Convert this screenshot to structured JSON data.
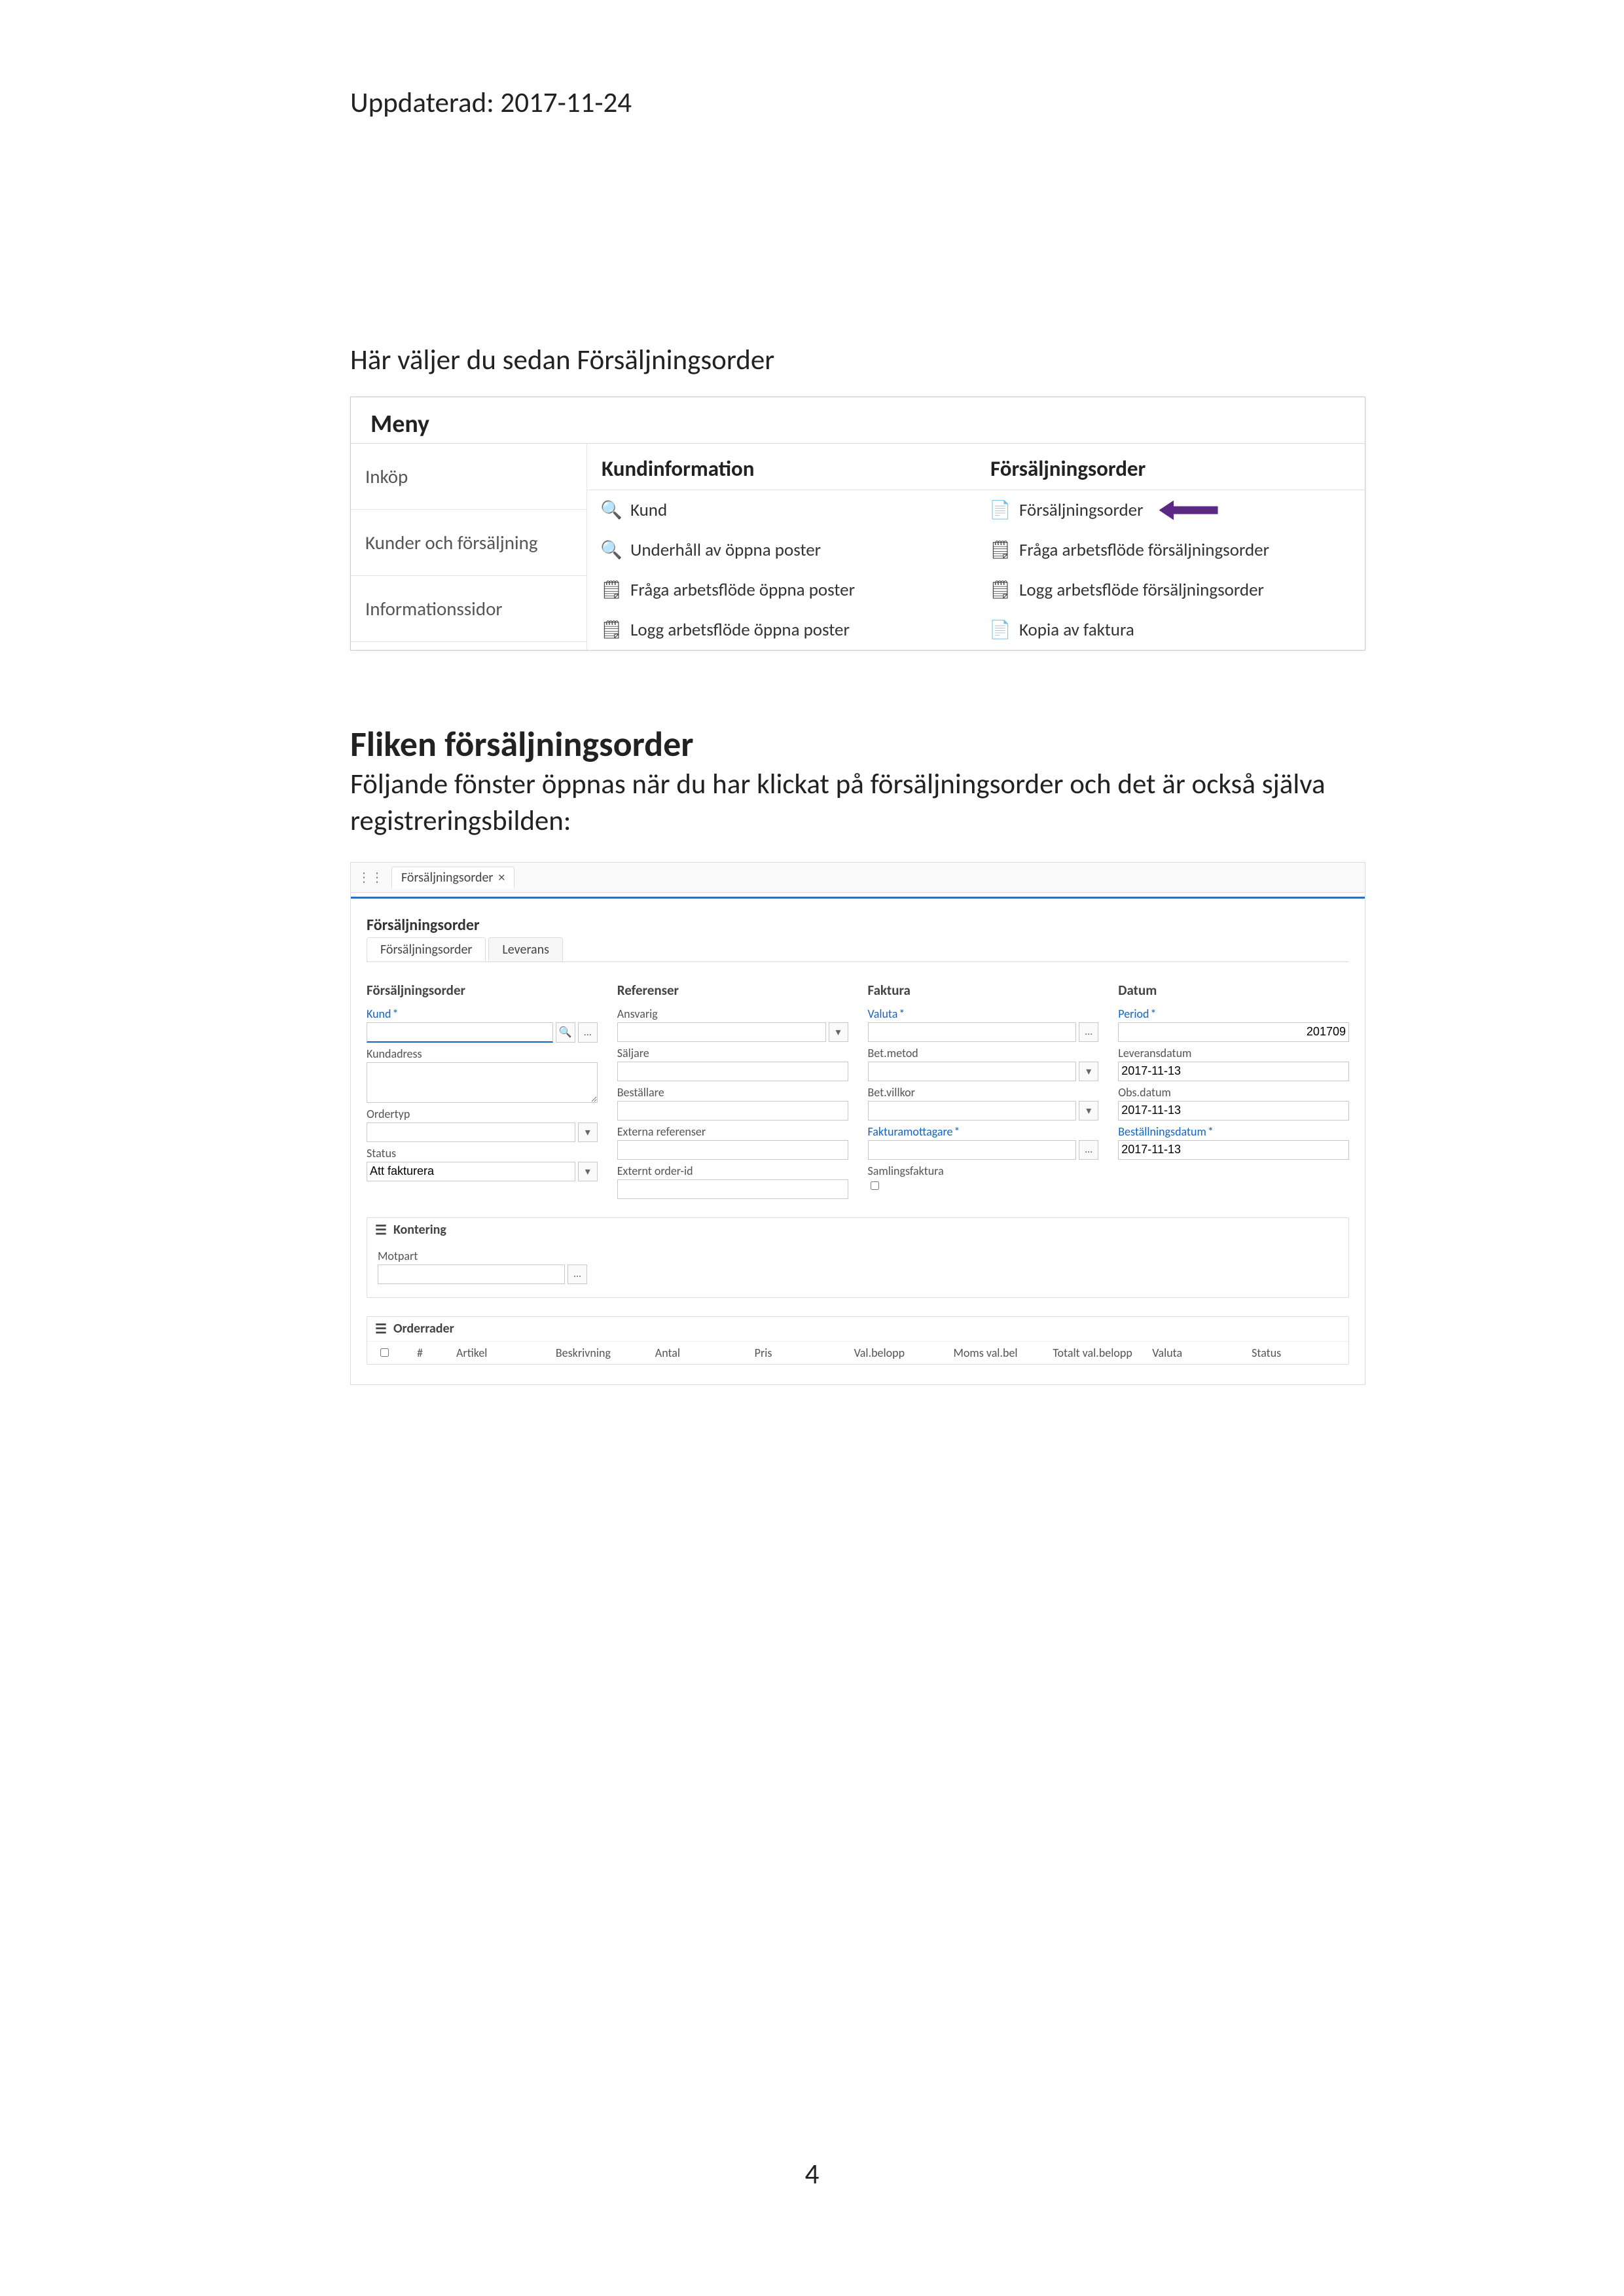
{
  "updated": "Uppdaterad: 2017-11-24",
  "instruction": "Här väljer du sedan Försäljningsorder",
  "section_title": "Fliken försäljningsorder",
  "section_body": "Följande fönster öppnas när du har klickat på försäljningsorder och det är också själva registreringsbilden:",
  "page_number": "4",
  "menu": {
    "title": "Meny",
    "sidebar": [
      "Inköp",
      "Kunder och försäljning",
      "Informationssidor"
    ],
    "col1": {
      "heading": "Kundinformation",
      "items": [
        "Kund",
        "Underhåll av öppna poster",
        "Fråga arbetsflöde öppna poster",
        "Logg arbetsflöde öppna poster"
      ]
    },
    "col2": {
      "heading": "Försäljningsorder",
      "items": [
        "Försäljningsorder",
        "Fråga arbetsflöde försäljningsorder",
        "Logg arbetsflöde försäljningsorder",
        "Kopia av faktura"
      ]
    }
  },
  "window": {
    "tab": "Försäljningsorder",
    "tab_close": "×",
    "heading": "Försäljningsorder",
    "subtabs": {
      "active": "Försäljningsorder",
      "other": "Leverans"
    },
    "col1": {
      "title": "Försäljningsorder",
      "kund_label": "Kund",
      "kund_value": "",
      "kundadress_label": "Kundadress",
      "ordertyp_label": "Ordertyp",
      "status_label": "Status",
      "status_value": "Att fakturera"
    },
    "col2": {
      "title": "Referenser",
      "ansvarig_label": "Ansvarig",
      "saljare_label": "Säljare",
      "bestallare_label": "Beställare",
      "ext_ref_label": "Externa referenser",
      "ext_order_label": "Externt order-id"
    },
    "col3": {
      "title": "Faktura",
      "valuta_label": "Valuta",
      "betmetod_label": "Bet.metod",
      "betvillkor_label": "Bet.villkor",
      "fmottagare_label": "Fakturamottagare",
      "samling_label": "Samlingsfaktura"
    },
    "col4": {
      "title": "Datum",
      "period_label": "Period",
      "period_value": "201709",
      "lev_label": "Leveransdatum",
      "lev_value": "2017-11-13",
      "obs_label": "Obs.datum",
      "obs_value": "2017-11-13",
      "best_label": "Beställningsdatum",
      "best_value": "2017-11-13"
    },
    "kontering": {
      "title": "Kontering",
      "motpart_label": "Motpart"
    },
    "orderrader": {
      "title": "Orderrader",
      "cols": [
        "#",
        "Artikel",
        "Beskrivning",
        "Antal",
        "Pris",
        "Val.belopp",
        "Moms val.bel",
        "Totalt val.belopp",
        "Valuta",
        "Status"
      ]
    }
  }
}
